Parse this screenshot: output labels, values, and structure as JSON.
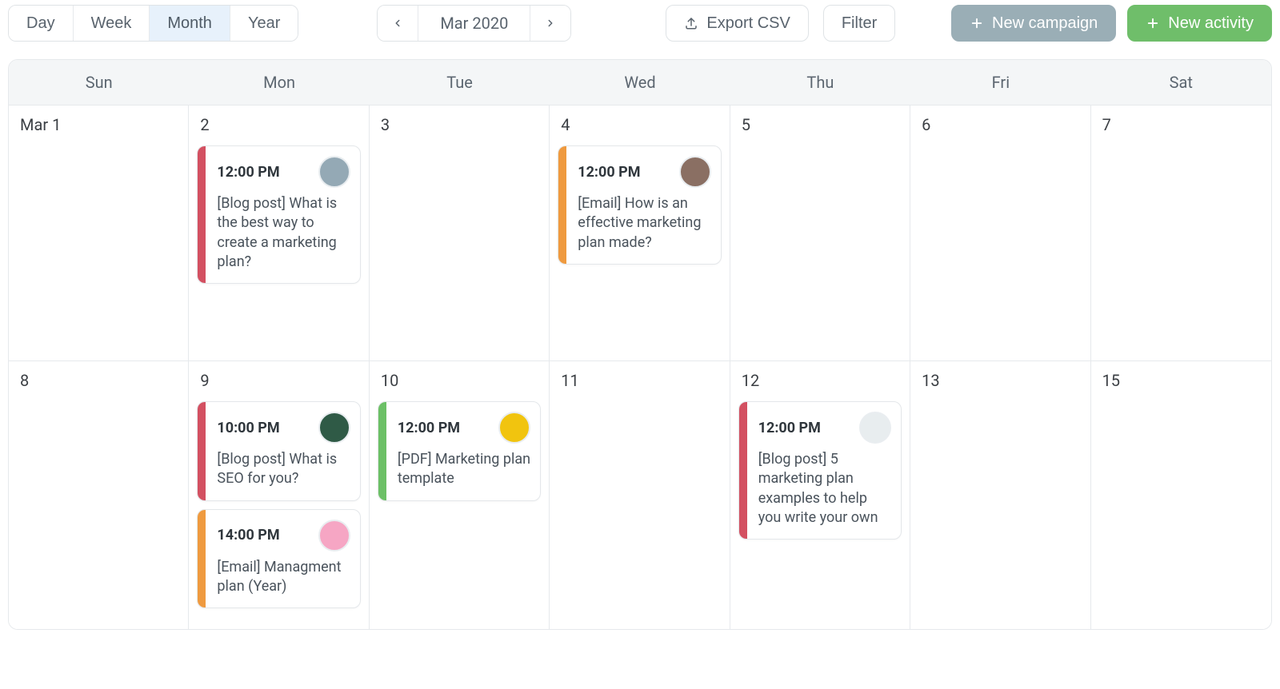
{
  "colors": {
    "red": "#d35061",
    "orange": "#ef9a3f",
    "green": "#6cc066",
    "avatar_ring": "#e9edf0"
  },
  "toolbar": {
    "views": [
      "Day",
      "Week",
      "Month",
      "Year"
    ],
    "active_view_index": 2,
    "period_label": "Mar 2020",
    "export_label": "Export CSV",
    "filter_label": "Filter",
    "new_campaign_label": "New campaign",
    "new_activity_label": "New activity"
  },
  "calendar": {
    "dow": [
      "Sun",
      "Mon",
      "Tue",
      "Wed",
      "Thu",
      "Fri",
      "Sat"
    ],
    "weeks": [
      {
        "days": [
          {
            "label": "Mar 1",
            "events": []
          },
          {
            "label": "2",
            "events": [
              {
                "time": "12:00 PM",
                "title": "[Blog post] What is the best way to create a marketing plan?",
                "color": "red",
                "avatar_bg": "#94a9b5"
              }
            ]
          },
          {
            "label": "3",
            "events": []
          },
          {
            "label": "4",
            "events": [
              {
                "time": "12:00 PM",
                "title": "[Email] How is an effective marketing plan made?",
                "color": "orange",
                "avatar_bg": "#8a6f63"
              }
            ]
          },
          {
            "label": "5",
            "events": []
          },
          {
            "label": "6",
            "events": []
          },
          {
            "label": "7",
            "events": []
          }
        ]
      },
      {
        "days": [
          {
            "label": "8",
            "events": []
          },
          {
            "label": "9",
            "events": [
              {
                "time": "10:00 PM",
                "title": "[Blog post] What is SEO for you?",
                "color": "red",
                "avatar_bg": "#2f5a46"
              },
              {
                "time": "14:00 PM",
                "title": "[Email] Managment plan (Year)",
                "color": "orange",
                "avatar_bg": "#f6a6c4"
              }
            ]
          },
          {
            "label": "10",
            "events": [
              {
                "time": "12:00 PM",
                "title": "[PDF] Marketing plan template",
                "color": "green",
                "avatar_bg": "#f1c40f"
              }
            ]
          },
          {
            "label": "11",
            "events": []
          },
          {
            "label": "12",
            "events": [
              {
                "time": "12:00 PM",
                "title": "[Blog post] 5 marketing plan examples to help you write your own",
                "color": "red",
                "avatar_bg": "#e8edef"
              }
            ]
          },
          {
            "label": "13",
            "events": []
          },
          {
            "label": "15",
            "events": []
          }
        ]
      }
    ]
  }
}
